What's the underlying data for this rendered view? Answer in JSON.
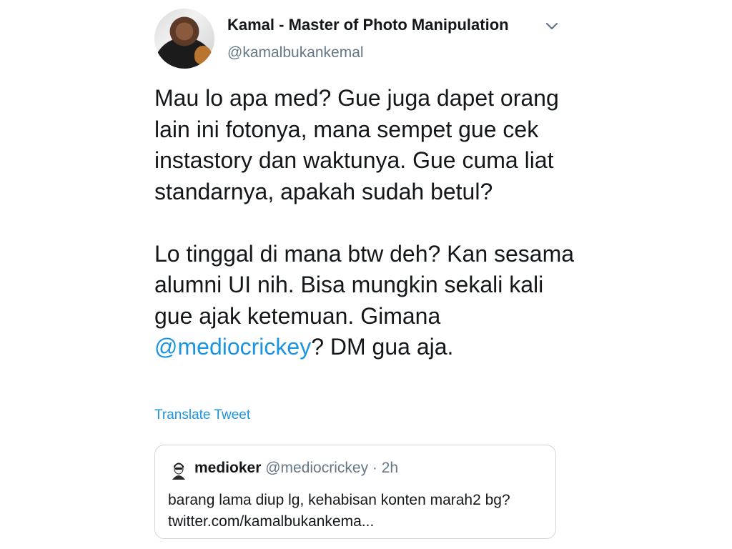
{
  "author": {
    "name": "Kamal - Master of Photo Manipulation",
    "handle": "@kamalbukankemal"
  },
  "tweet": {
    "paragraph1": "Mau lo apa med? Gue juga dapet orang lain ini fotonya, mana sempet gue cek instastory dan waktunya. Gue cuma liat standarnya, apakah sudah betul?",
    "paragraph2_prefix": "Lo tinggal di mana btw deh? Kan sesama alumni UI nih. Bisa mungkin sekali kali gue ajak ketemuan. Gimana ",
    "mention": "@mediocrickey",
    "paragraph2_suffix": "? DM gua aja."
  },
  "translate_label": "Translate Tweet",
  "quoted": {
    "name": "medioker",
    "handle": "@mediocrickey",
    "separator": " · ",
    "time": "2h",
    "line1": "barang lama diup lg, kehabisan konten marah2 bg?",
    "line2": "twitter.com/kamalbukankema..."
  },
  "icons": {
    "menu": "chevron-down-icon"
  },
  "colors": {
    "link": "#1b95e0",
    "secondary_text": "#657786",
    "border": "#ccd6dd"
  }
}
